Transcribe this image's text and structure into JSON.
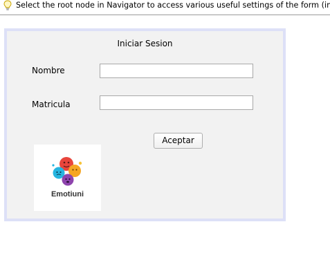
{
  "hint": {
    "text": "Select the root node in Navigator to access various useful settings of the form (in Prop",
    "icon": "lightbulb-icon"
  },
  "form": {
    "title": "Iniciar Sesion",
    "nombre_label": "Nombre",
    "nombre_value": "",
    "matricula_label": "Matricula",
    "matricula_value": "",
    "submit_label": "Aceptar"
  },
  "logo": {
    "text": "Emotiuni",
    "colors": [
      "#e8453c",
      "#f5a623",
      "#26b5e0",
      "#8e44ad",
      "#f7c43a"
    ]
  },
  "colors": {
    "frame_border": "#dde0f7",
    "panel_bg": "#f2f2f2"
  }
}
